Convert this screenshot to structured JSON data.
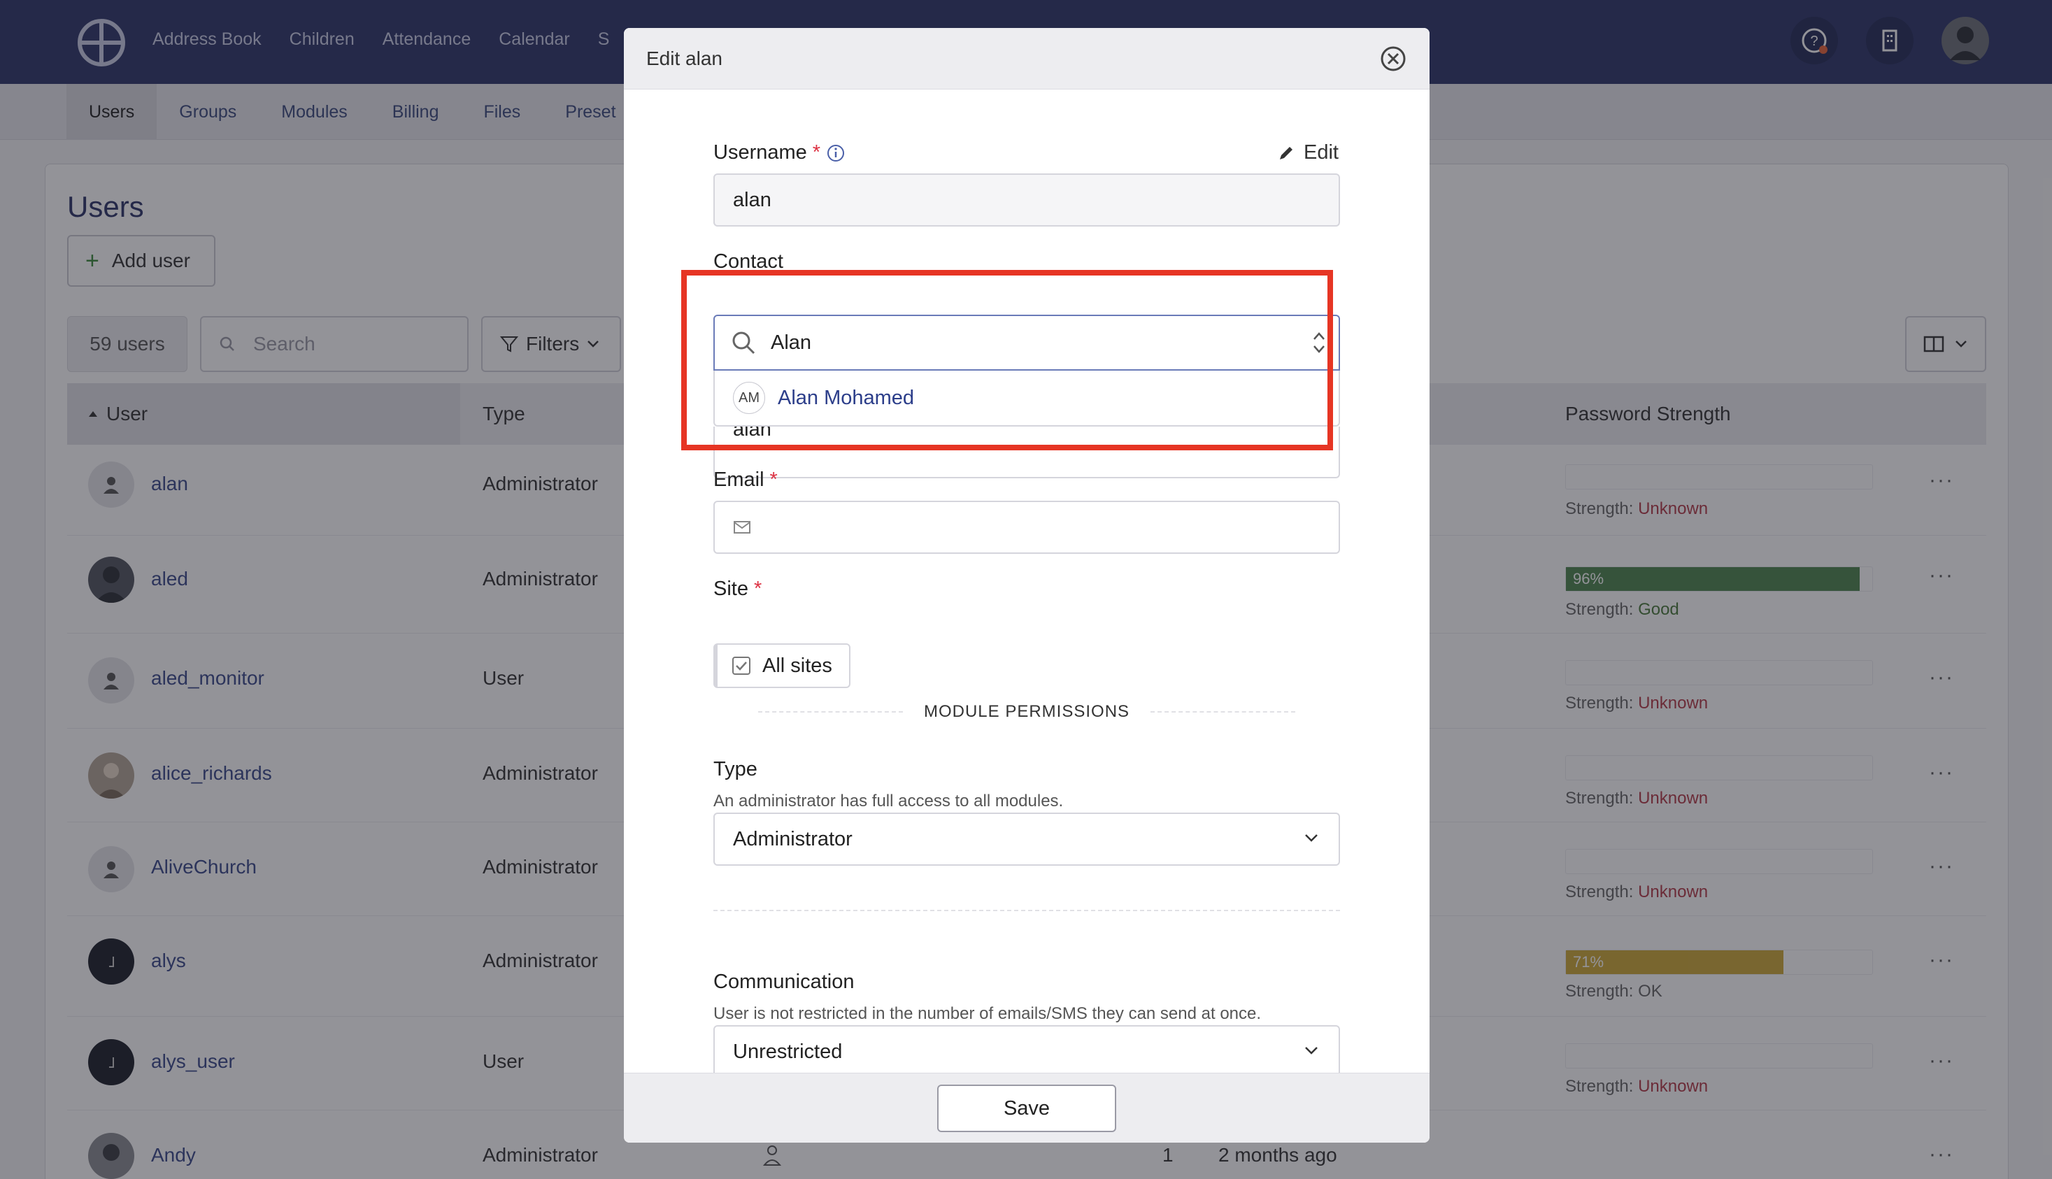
{
  "topnav": {
    "items": [
      "Address Book",
      "Children",
      "Attendance",
      "Calendar",
      "S"
    ]
  },
  "subnav": {
    "items": [
      "Users",
      "Groups",
      "Modules",
      "Billing",
      "Files",
      "Preset"
    ]
  },
  "page": {
    "title": "Users",
    "add_user": "Add user",
    "count": "59 users",
    "search_placeholder": "Search",
    "filters": "Filters"
  },
  "table": {
    "columns": {
      "user": "User",
      "type": "Type",
      "password_strength": "Password Strength"
    },
    "strength_prefix": "Strength: ",
    "rows": [
      {
        "name": "alan",
        "type": "Administrator",
        "strength": "Unknown"
      },
      {
        "name": "aled",
        "type": "Administrator",
        "strength": "Good",
        "percent": "96%",
        "fill": 0.96
      },
      {
        "name": "aled_monitor",
        "type": "User",
        "strength": "Unknown"
      },
      {
        "name": "alice_richards",
        "type": "Administrator",
        "strength": "Unknown"
      },
      {
        "name": "AliveChurch",
        "type": "Administrator",
        "strength": "Unknown"
      },
      {
        "name": "alys",
        "type": "Administrator",
        "strength": "OK",
        "percent": "71%",
        "fill": 0.71
      },
      {
        "name": "alys_user",
        "type": "User",
        "strength": "Unknown"
      },
      {
        "name": "Andy",
        "type": "Administrator",
        "extra_count": "1",
        "extra_when": "2 months ago"
      }
    ]
  },
  "colors": {
    "topbar": "#2c3468",
    "good": "#3e7a3e",
    "ok": "#c9a227",
    "unknown": "#b23a48",
    "highlight": "#e63524"
  },
  "modal": {
    "title": "Edit alan",
    "username_label": "Username",
    "required_mark": "*",
    "edit_label": "Edit",
    "username_value": "alan",
    "contact_label": "Contact",
    "contact_value": "Alan",
    "contact_option_initials": "AM",
    "contact_option_name": "Alan Mohamed",
    "hidden_field_value": "alan",
    "email_label": "Email",
    "site_label": "Site",
    "site_value": "All sites",
    "module_permissions": "MODULE PERMISSIONS",
    "type_label": "Type",
    "type_help": "An administrator has full access to all modules.",
    "type_value": "Administrator",
    "communication_label": "Communication",
    "communication_help": "User is not restricted in the number of emails/SMS they can send at once.",
    "communication_value": "Unrestricted",
    "save_label": "Save"
  }
}
